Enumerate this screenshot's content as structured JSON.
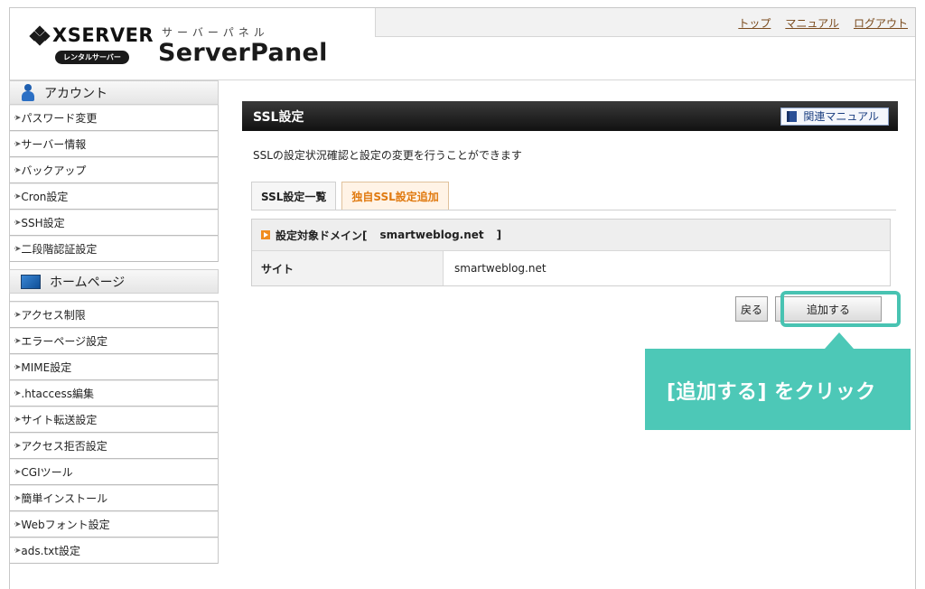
{
  "header": {
    "brand": "XSERVER",
    "rental_badge": "レンタルサーバー",
    "subtitle": "サーバーパネル",
    "panel_title": "ServerPanel",
    "nav": [
      "トップ",
      "マニュアル",
      "ログアウト"
    ]
  },
  "sidebar": {
    "account": {
      "title": "アカウント",
      "icon": "user-icon",
      "items": [
        "パスワード変更",
        "サーバー情報",
        "バックアップ",
        "Cron設定",
        "SSH設定",
        "二段階認証設定"
      ]
    },
    "homepage": {
      "title": "ホームページ",
      "icon": "monitor-icon",
      "items": [
        "アクセス制限",
        "エラーページ設定",
        "MIME設定",
        ".htaccess編集",
        "サイト転送設定",
        "アクセス拒否設定",
        "CGIツール",
        "簡単インストール",
        "Webフォント設定",
        "ads.txt設定"
      ]
    }
  },
  "main": {
    "title": "SSL設定",
    "manual_button": "関連マニュアル",
    "description": "SSLの設定状況確認と設定の変更を行うことができます",
    "tabs": [
      "SSL設定一覧",
      "独自SSL設定追加"
    ],
    "active_tab": 1,
    "domain_label": "設定対象ドメイン[",
    "domain_value": "smartweblog.net",
    "domain_close": "]",
    "site_label": "サイト",
    "site_value": "smartweblog.net",
    "back_button": "戻る",
    "add_button": "追加する"
  },
  "callout": {
    "text": "[追加する] をクリック"
  },
  "colors": {
    "accent_orange": "#e07a10",
    "callout_teal": "#4dc8b7",
    "title_bar": "#111111",
    "nav_link": "#7a4a1c"
  }
}
